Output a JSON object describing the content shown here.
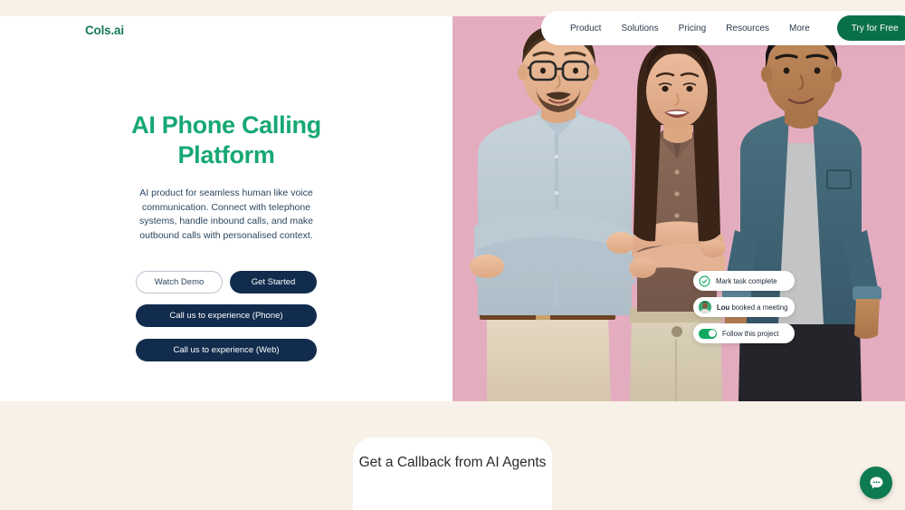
{
  "brand": {
    "logo_text": "Cols.ai",
    "logo_color": "#17795a",
    "accent_green": "#16a873",
    "nav_green": "#0a7048",
    "dark_navy": "#122c4d",
    "cream": "#f8f1e7",
    "hero_pink": "#e3adbf"
  },
  "nav": {
    "links": [
      {
        "label": "Product"
      },
      {
        "label": "Solutions"
      },
      {
        "label": "Pricing"
      },
      {
        "label": "Resources"
      },
      {
        "label": "More"
      }
    ],
    "cta_label": "Try for Free"
  },
  "hero": {
    "title": "AI Phone Calling Platform",
    "subtitle": "AI product for seamless human like voice communication. Connect with telephone systems, handle inbound calls, and make outbound calls with personalised context.",
    "buttons": {
      "watch_demo": "Watch Demo",
      "get_started": "Get Started",
      "call_phone": "Call us to experience (Phone)",
      "call_web": "Call us to experience (Web)"
    }
  },
  "float_cards": [
    {
      "icon": "check-circle-icon",
      "text": "Mark task complete"
    },
    {
      "icon": "avatar-icon",
      "name": "Lou",
      "text": " booked a meeting"
    },
    {
      "icon": "toggle-on-icon",
      "text": "Follow this project"
    }
  ],
  "callback_section": {
    "title": "Get a Callback from AI Agents"
  },
  "chat_widget": {
    "icon": "chat-bubble-icon"
  }
}
